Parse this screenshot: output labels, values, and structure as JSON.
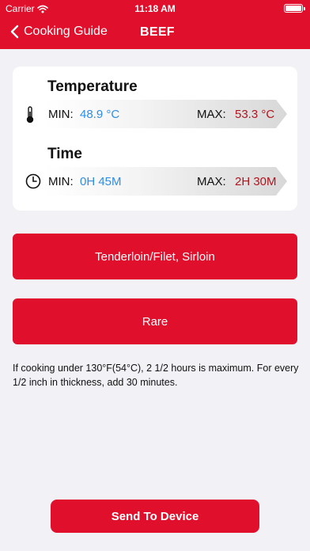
{
  "status_bar": {
    "carrier": "Carrier",
    "time": "11:18 AM"
  },
  "nav": {
    "back_label": "Cooking Guide",
    "title": "BEEF"
  },
  "temperature": {
    "title": "Temperature",
    "min_label": "MIN:",
    "min_value": "48.9 °C",
    "max_label": "MAX:",
    "max_value": "53.3 °C"
  },
  "time": {
    "title": "Time",
    "min_label": "MIN:",
    "min_value": "0H 45M",
    "max_label": "MAX:",
    "max_value": "2H 30M"
  },
  "options": {
    "cut_label": "Tenderloin/Filet, Sirloin",
    "doneness_label": "Rare"
  },
  "note": "If cooking under 130°F(54°C), 2 1/2 hours is maximum. For every 1/2 inch in thickness, add 30 minutes.",
  "send_label": "Send To Device",
  "colors": {
    "accent": "#e0102c",
    "min_value": "#2f8de4",
    "max_value": "#b0151e",
    "background": "#f2f2f6"
  },
  "icons": [
    "wifi-icon",
    "battery-icon",
    "chevron-left-icon",
    "thermometer-icon",
    "clock-icon"
  ]
}
